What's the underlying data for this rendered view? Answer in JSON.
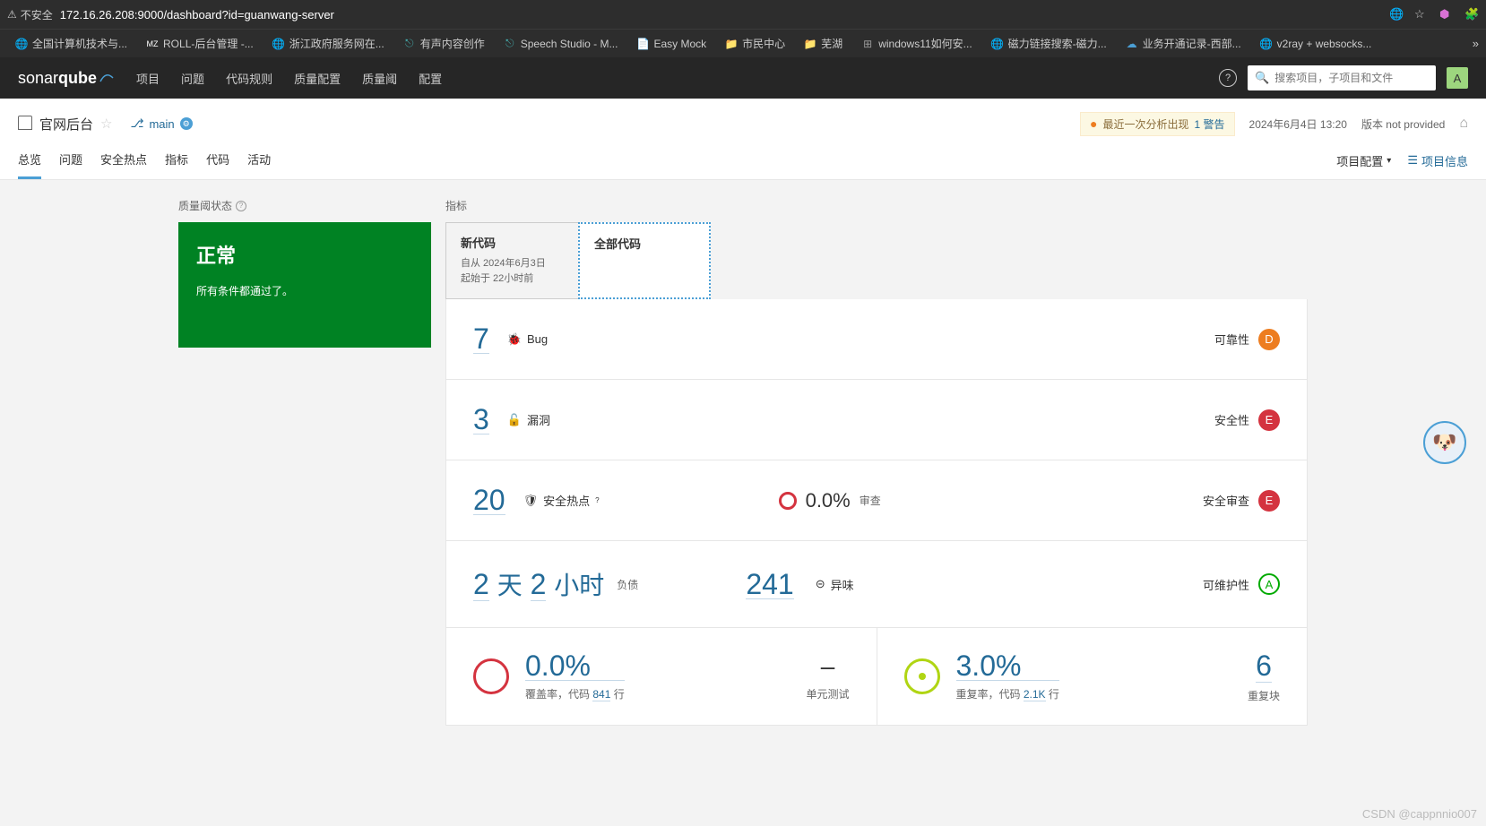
{
  "browser": {
    "insecure_label": "不安全",
    "url": "172.16.26.208:9000/dashboard?id=guanwang-server",
    "bookmarks": [
      {
        "label": "全国计算机技术与...",
        "icon": "globe"
      },
      {
        "label": "ROLL-后台管理 -...",
        "icon": "mz"
      },
      {
        "label": "浙江政府服务网在...",
        "icon": "globe"
      },
      {
        "label": "有声内容创作",
        "icon": "wave"
      },
      {
        "label": "Speech Studio - M...",
        "icon": "wave"
      },
      {
        "label": "Easy Mock",
        "icon": "doc"
      },
      {
        "label": "市民中心",
        "icon": "folder"
      },
      {
        "label": "芜湖",
        "icon": "folder"
      },
      {
        "label": "windows11如何安...",
        "icon": "win"
      },
      {
        "label": "磁力链接搜索-磁力...",
        "icon": "globe"
      },
      {
        "label": "业务开通记录-西部...",
        "icon": "cloud"
      },
      {
        "label": "v2ray + websocks...",
        "icon": "globe"
      }
    ]
  },
  "header": {
    "logo_a": "sonar",
    "logo_b": "qube",
    "nav": [
      "项目",
      "问题",
      "代码规则",
      "质量配置",
      "质量阈",
      "配置"
    ],
    "search_placeholder": "搜索项目，子项目和文件",
    "avatar": "A"
  },
  "project": {
    "name": "官网后台",
    "branch": "main",
    "warning_prefix": "最近一次分析出现",
    "warning_link": "1 警告",
    "analysis_date": "2024年6月4日 13:20",
    "version_label": "版本 not provided",
    "tabs": [
      "总览",
      "问题",
      "安全热点",
      "指标",
      "代码",
      "活动"
    ],
    "config_label": "项目配置",
    "info_label": "项目信息"
  },
  "quality_gate": {
    "title": "质量阈状态",
    "status": "正常",
    "desc": "所有条件都通过了。"
  },
  "metrics_title": "指标",
  "code_tabs": {
    "new": {
      "label": "新代码",
      "since": "自从 2024年6月3日",
      "started": "起始于 22小时前"
    },
    "all": {
      "label": "全部代码"
    }
  },
  "metrics": {
    "bugs": {
      "value": "7",
      "label": "Bug",
      "rating_label": "可靠性",
      "rating": "D"
    },
    "vulns": {
      "value": "3",
      "label": "漏洞",
      "rating_label": "安全性",
      "rating": "E"
    },
    "hotspots": {
      "value": "20",
      "label": "安全热点",
      "reviewed_pct": "0.0%",
      "reviewed_label": "审查",
      "rating_label": "安全审查",
      "rating": "E"
    },
    "debt": {
      "value_days": "2",
      "unit_days": "天",
      "value_hours": "2",
      "unit_hours": "小时",
      "label": "负债",
      "smells": "241",
      "smells_label": "异味",
      "rating_label": "可维护性",
      "rating": "A"
    },
    "coverage": {
      "pct": "0.0%",
      "label_pre": "覆盖率，代码",
      "lines": "841",
      "label_post": "行",
      "unit_tests_value": "–",
      "unit_tests_label": "单元测试"
    },
    "duplication": {
      "pct": "3.0%",
      "label_pre": "重复率，代码",
      "lines": "2.1K",
      "label_post": "行",
      "blocks": "6",
      "blocks_label": "重复块"
    }
  },
  "watermark": "CSDN @cappnnio007"
}
